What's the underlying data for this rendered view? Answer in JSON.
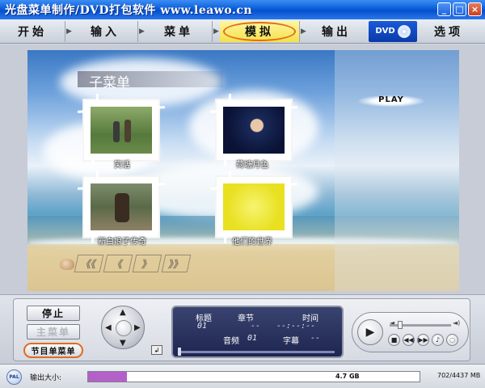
{
  "window": {
    "title": "光盘菜单制作/DVD打包软件 www.leawo.cn",
    "minimize": "_",
    "maximize": "□",
    "close": "×"
  },
  "toolbar": {
    "tabs": [
      {
        "label": "开始"
      },
      {
        "label": "输入"
      },
      {
        "label": "菜单"
      },
      {
        "label": "模拟",
        "selected": true
      },
      {
        "label": "输出"
      },
      {
        "label": "选项"
      }
    ],
    "dvd_logo": "DVD"
  },
  "preview": {
    "menu_title": "子菜单",
    "play_label": "PLAY",
    "items": [
      {
        "caption": "笑话",
        "thumb": "video-thumbnail-countryside"
      },
      {
        "caption": "荷塘月色",
        "thumb": "video-thumbnail-stage"
      },
      {
        "caption": "新白娘子传奇",
        "thumb": "video-thumbnail-drama"
      },
      {
        "caption": "他们的世界",
        "thumb": "video-thumbnail-yellow"
      }
    ],
    "nav_buttons": [
      "《《",
      "《",
      "》",
      "》》"
    ]
  },
  "controls": {
    "stop": "停止",
    "main_menu": "主菜单",
    "title_menu": "节目单菜单",
    "lcd": {
      "title_label": "标题",
      "title_value": "01",
      "chapter_label": "章节",
      "chapter_value": "--",
      "time_label": "时间",
      "time_value": "--:--:--",
      "audio_label": "音频",
      "audio_value": "01",
      "subtitle_label": "字幕",
      "subtitle_value": "--"
    }
  },
  "status": {
    "format": "PAL",
    "size_label": "输出大小:",
    "capacity_mark": "4.7 GB",
    "usage": "702/4437 MB",
    "used_mb": 702,
    "total_mb": 4437
  },
  "colors": {
    "accent_ring": "#e46a1f",
    "progress_fill": "#b55fc8",
    "selected_tab": "#f3e14a"
  }
}
